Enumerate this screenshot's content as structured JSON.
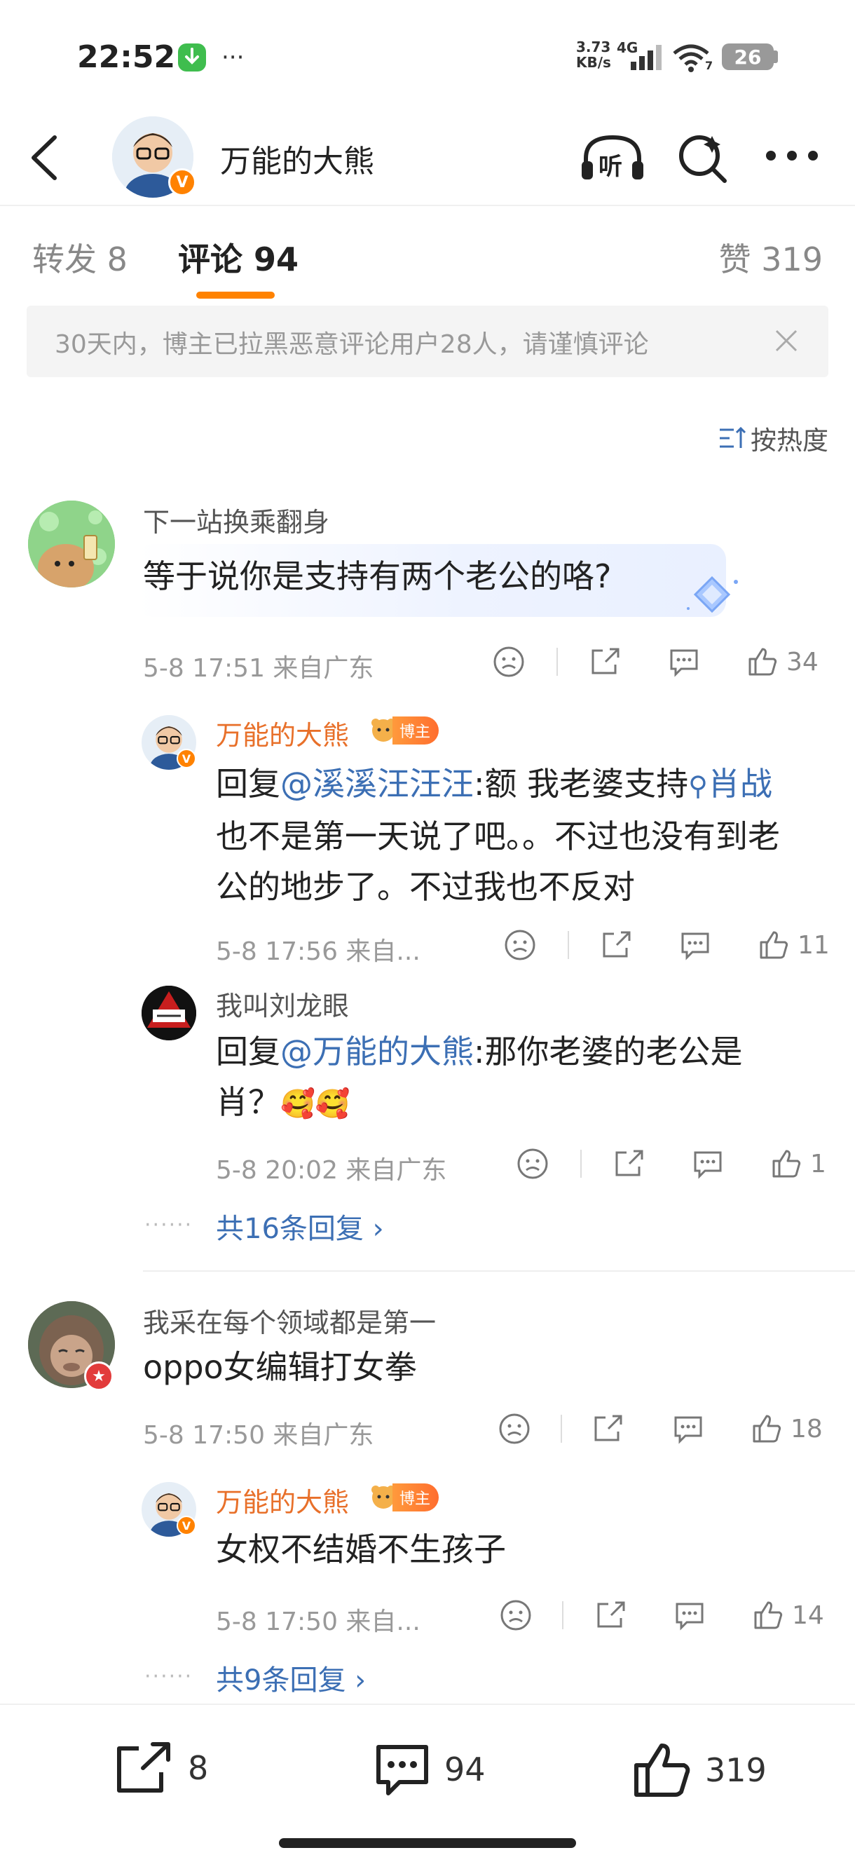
{
  "status_bar": {
    "time": "22:52",
    "speed_top": "3.73",
    "speed_bottom": "KB/s",
    "network": "4G",
    "wifi_sub": "7",
    "battery": "26"
  },
  "header": {
    "title": "万能的大熊",
    "listen_label": "听"
  },
  "tabs": {
    "repost": "转发 8",
    "comment": "评论 94",
    "like": "赞 319"
  },
  "notice": {
    "text": "30天内，博主已拉黑恶意评论用户28人，请谨慎评论"
  },
  "sort": {
    "label": "按热度"
  },
  "comments": [
    {
      "user": "下一站换乘翻身",
      "text": "等于说你是支持有两个老公的咯?",
      "meta": "5-8 17:51  来自广东",
      "likes": "34",
      "replies": [
        {
          "user": "万能的大熊",
          "badge": "博主",
          "prefix": "回复",
          "mention": "@溪溪汪汪汪",
          "text_a": ":额 我老婆支持",
          "topic": "肖战",
          "line2": "也不是第一天说了吧。。不过也没有到老",
          "line3": "公的地步了。不过我也不反对",
          "meta": "5-8 17:56  来自...",
          "likes": "11"
        },
        {
          "user": "我叫刘龙眼",
          "prefix": "回复",
          "mention": "@万能的大熊",
          "text_a": ":那你老婆的老公是",
          "line2": "肖？",
          "emoji": "🥰🥰",
          "meta": "5-8 20:02  来自广东",
          "likes": "1"
        }
      ],
      "more_replies": "共16条回复 ›"
    },
    {
      "user": "我采在每个领域都是第一",
      "text": "oppo女编辑打女拳",
      "meta": "5-8 17:50  来自广东",
      "likes": "18",
      "replies": [
        {
          "user": "万能的大熊",
          "badge": "博主",
          "text": "女权不结婚不生孩子",
          "meta": "5-8 17:50  来自...",
          "likes": "14"
        }
      ],
      "more_replies": "共9条回复 ›"
    }
  ],
  "bottom_bar": {
    "repost_count": "8",
    "comment_count": "94",
    "like_count": "319"
  },
  "colors": {
    "accent": "#ff8200",
    "mention": "#3c6fb4",
    "blogger_name": "#e8702a"
  }
}
